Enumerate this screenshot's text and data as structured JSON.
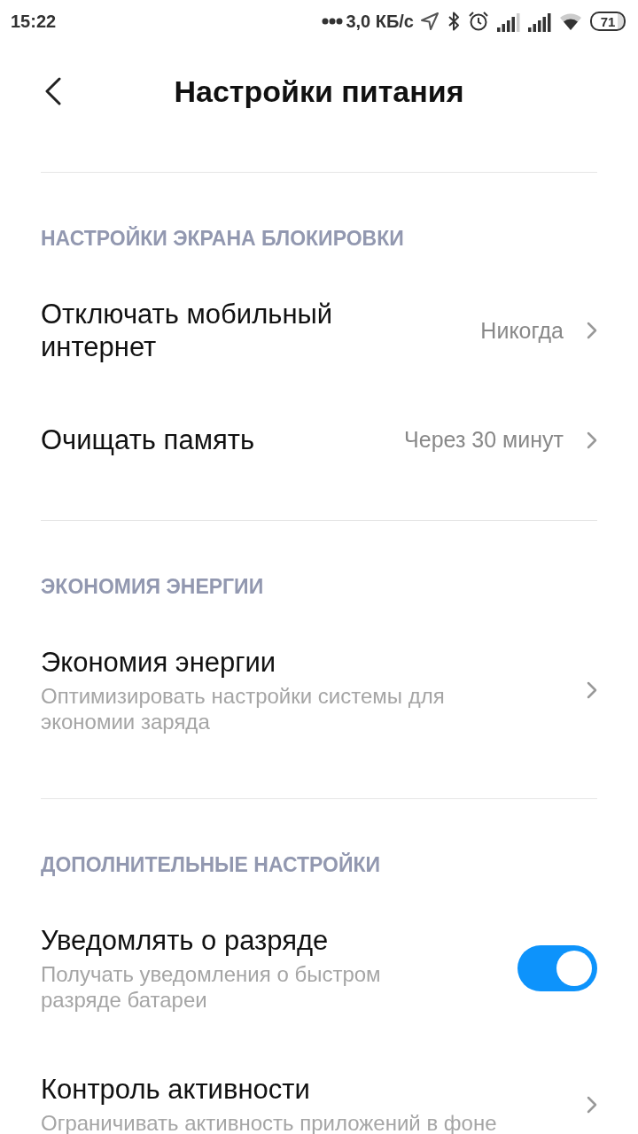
{
  "status_bar": {
    "time": "15:22",
    "network_speed": "3,0 КБ/с",
    "battery": "71"
  },
  "header": {
    "title": "Настройки питания"
  },
  "sections": [
    {
      "title": "НАСТРОЙКИ ЭКРАНА БЛОКИРОВКИ",
      "items": [
        {
          "kind": "value",
          "title": "Отключать мобильный интернет",
          "value": "Никогда"
        },
        {
          "kind": "value",
          "title": "Очищать память",
          "value": "Через 30 минут"
        }
      ]
    },
    {
      "title": "ЭКОНОМИЯ ЭНЕРГИИ",
      "items": [
        {
          "kind": "link",
          "title": "Экономия энергии",
          "subtitle": "Оптимизировать настройки системы для экономии заряда"
        }
      ]
    },
    {
      "title": "ДОПОЛНИТЕЛЬНЫЕ НАСТРОЙКИ",
      "items": [
        {
          "kind": "toggle",
          "title": "Уведомлять о разряде",
          "subtitle": "Получать уведомления о быстром разряде батареи",
          "on": true
        },
        {
          "kind": "link",
          "title": "Контроль активности",
          "subtitle": "Ограничивать активность приложений в фоне"
        }
      ]
    }
  ]
}
